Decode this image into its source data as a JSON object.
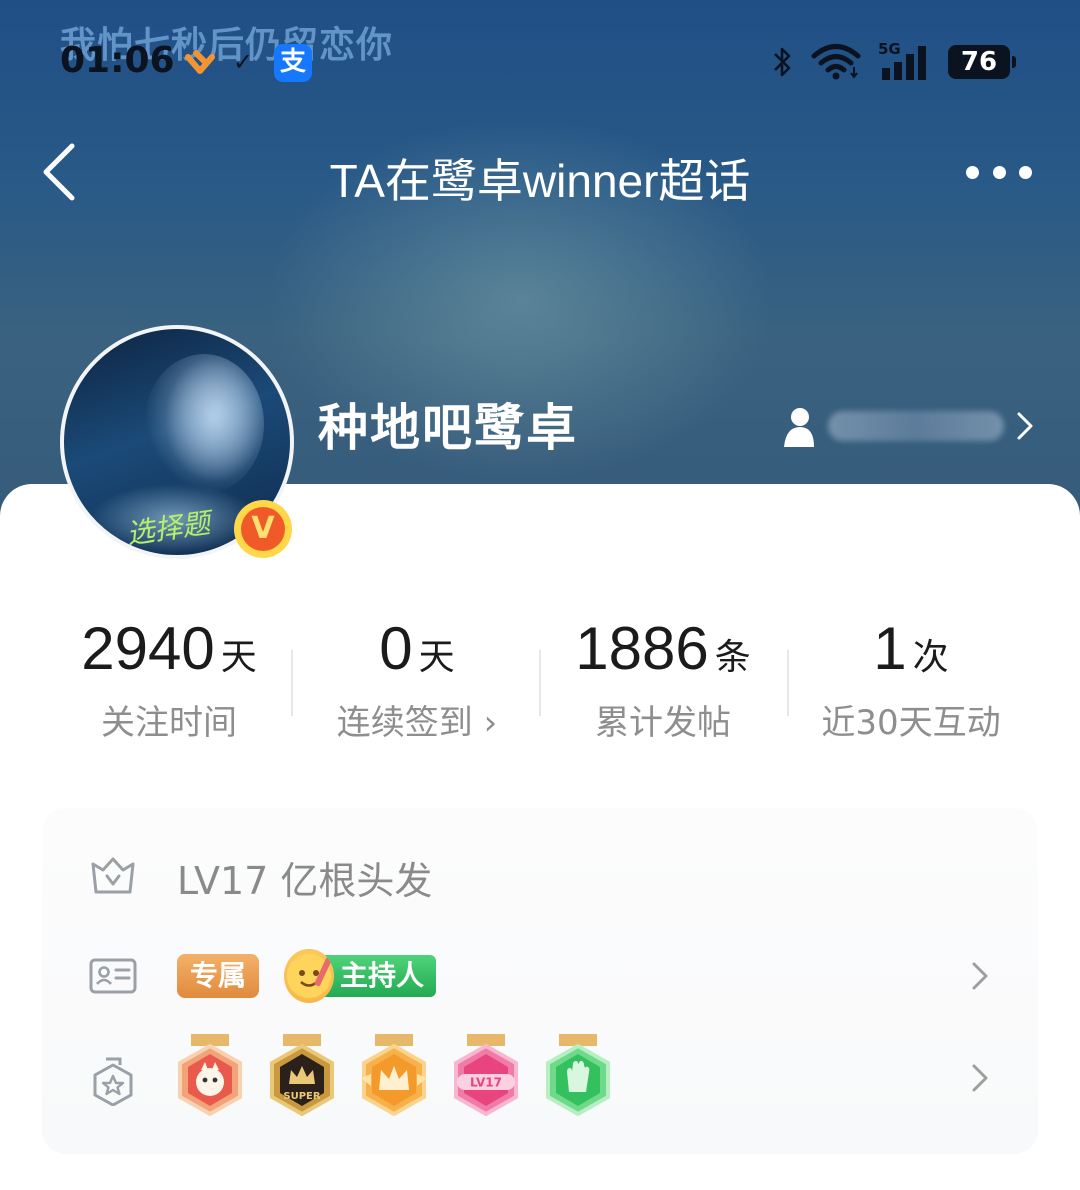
{
  "status_bar": {
    "lyric": "我怕七秒后仍留恋你",
    "time": "01:06",
    "alipay_glyph": "支",
    "network": "5G",
    "battery": "76"
  },
  "nav": {
    "title": "TA在鹭卓winner超话"
  },
  "profile": {
    "username": "种地吧鹭卓",
    "avatar_signature": "选择题",
    "verified_glyph": "V"
  },
  "stats": [
    {
      "value": "2940",
      "unit": "天",
      "label": "关注时间"
    },
    {
      "value": "0",
      "unit": "天",
      "label": "连续签到 ›"
    },
    {
      "value": "1886",
      "unit": "条",
      "label": "累计发帖"
    },
    {
      "value": "1",
      "unit": "次",
      "label": "近30天互动"
    }
  ],
  "info": {
    "level_text": "LV17 亿根头发",
    "tag_exclusive": "专属",
    "tag_host": "主持人",
    "medals": [
      "rabbit-medal",
      "super-medal",
      "crown-medal",
      "lv17-medal",
      "hand-medal"
    ],
    "medal_labels": {
      "super": "SUPER",
      "lv": "LV17"
    }
  },
  "colors": {
    "header_top": "#1f4f86",
    "host_green": "#22aa52",
    "exclusive_orange": "#e08a3c",
    "verified_orange": "#f05a28"
  }
}
